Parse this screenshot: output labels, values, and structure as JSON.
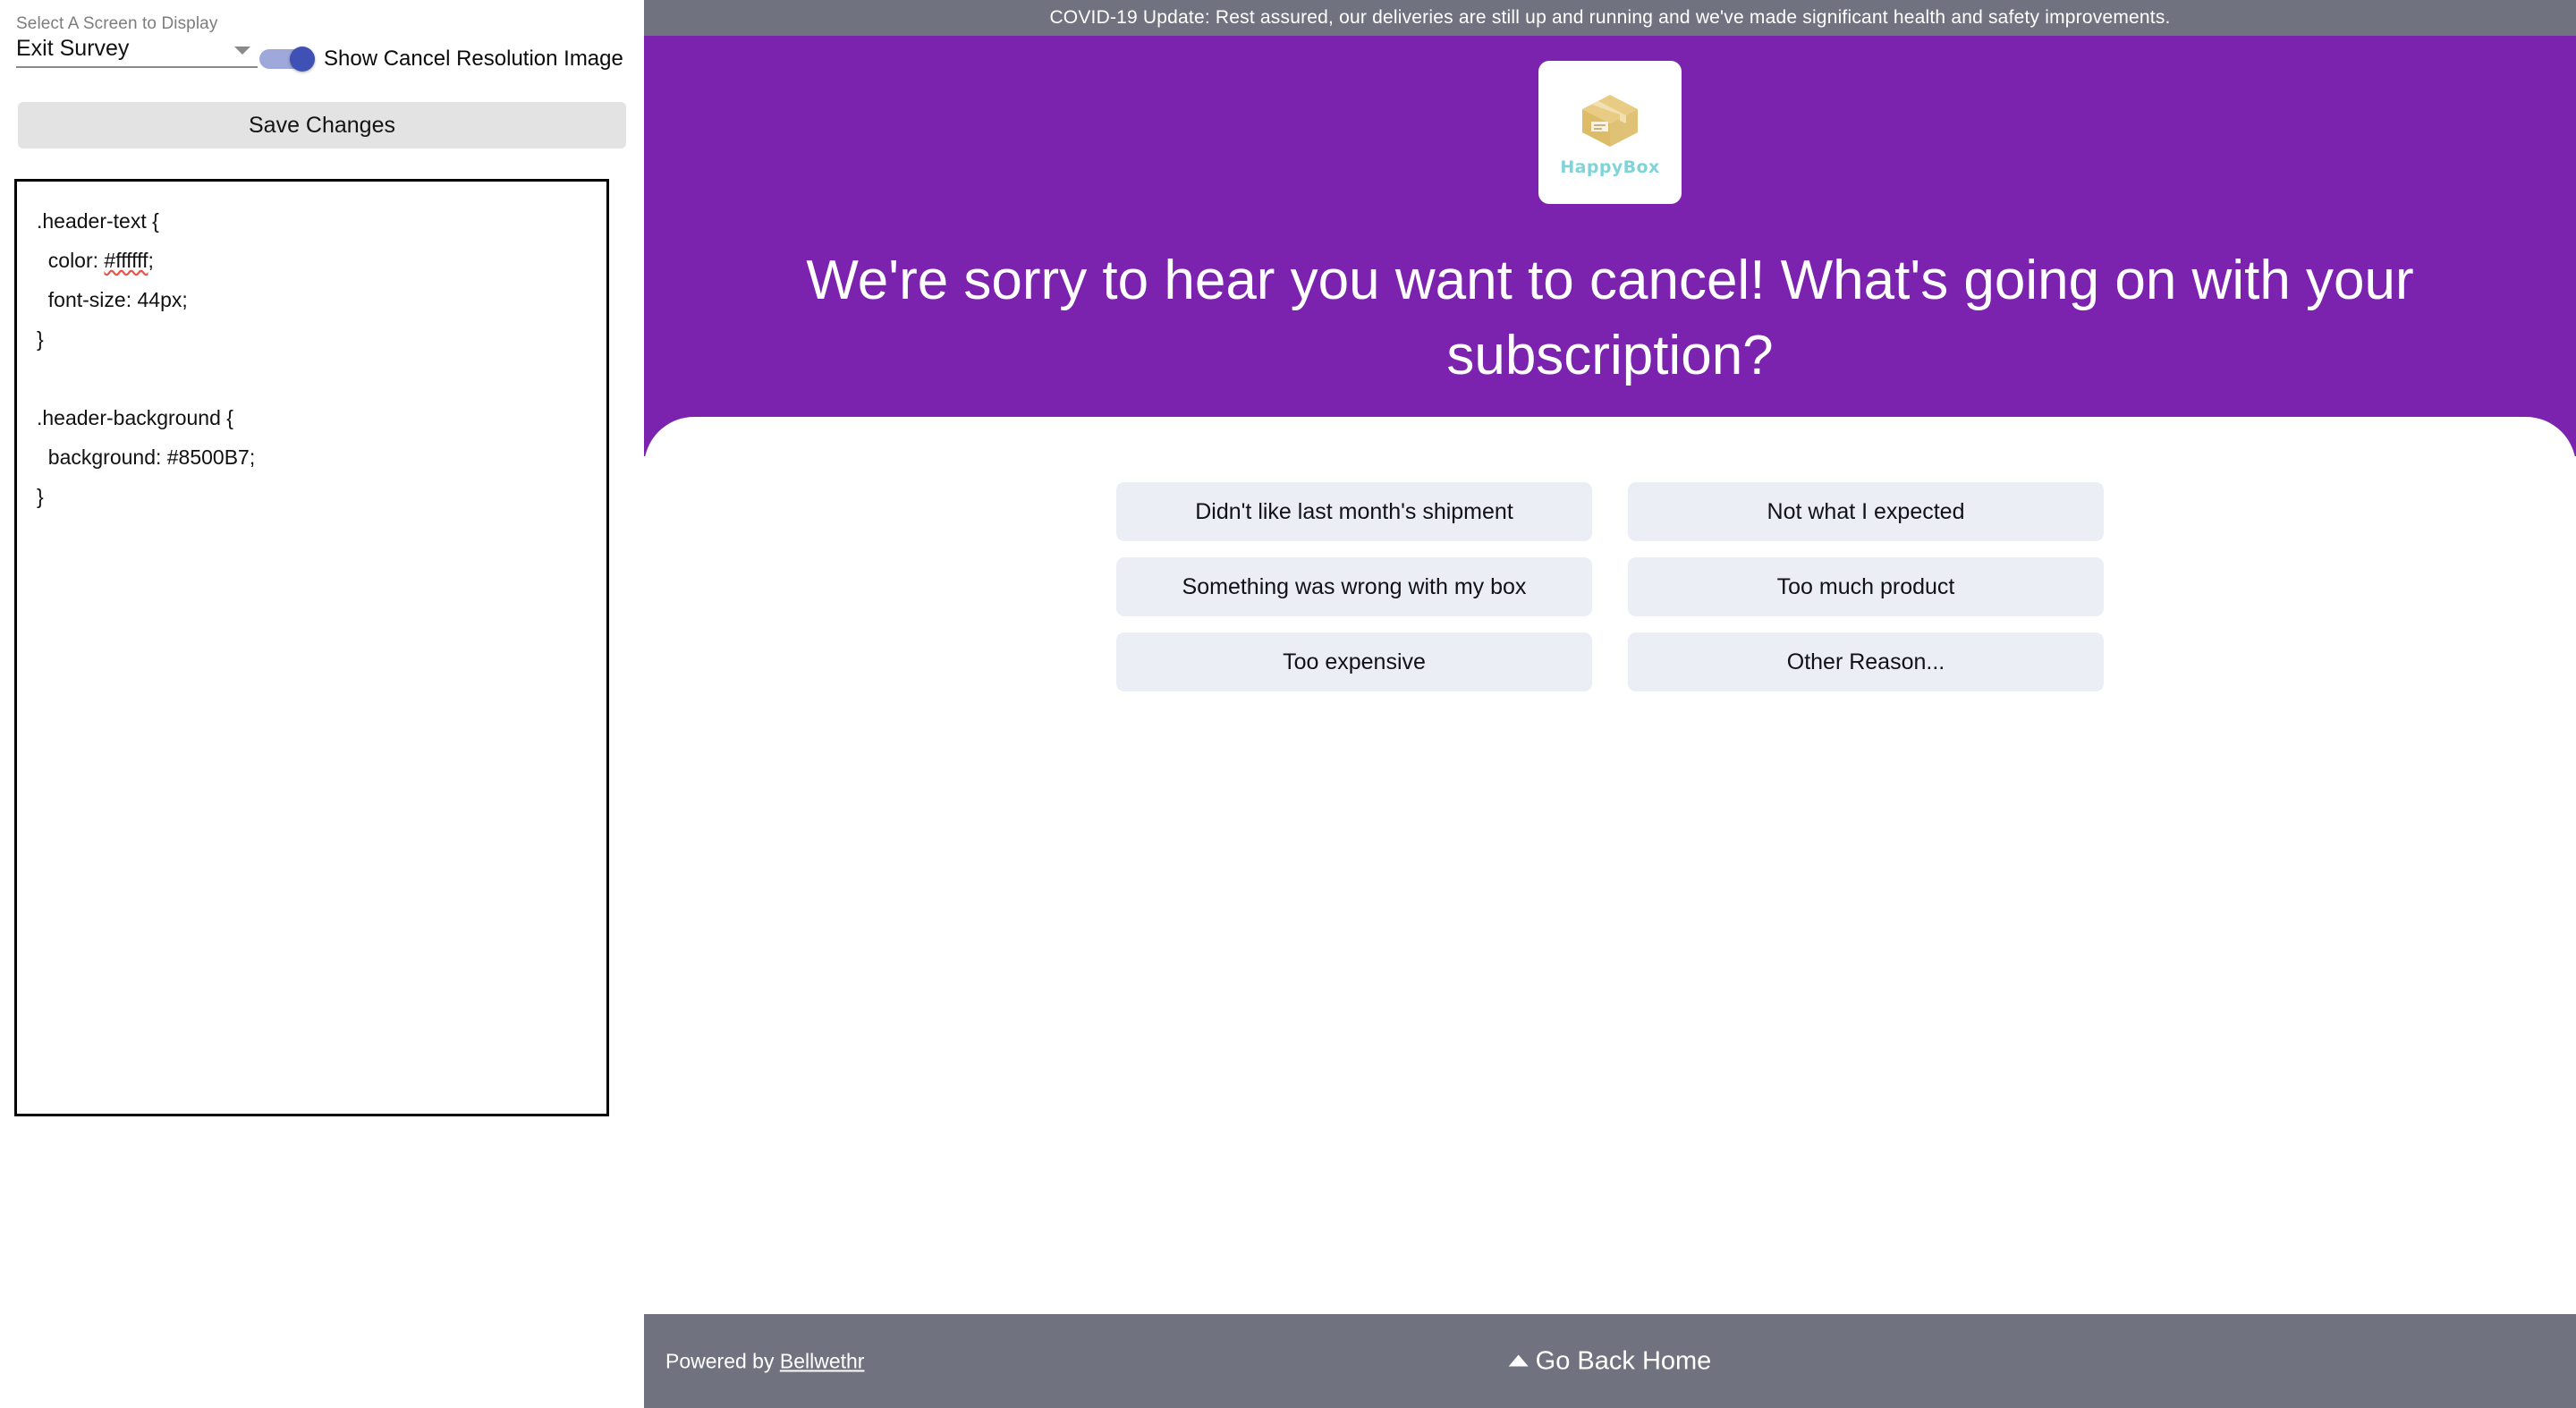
{
  "admin": {
    "screen_select": {
      "label": "Select A Screen to Display",
      "value": "Exit Survey",
      "arrow_icon": "chevron-down-icon"
    },
    "toggle": {
      "label": "Show Cancel Resolution Image",
      "state": "on"
    },
    "save_label": "Save Changes",
    "css_editor": {
      "line1": ".header-text {",
      "line2_prefix": "  color: ",
      "line2_value": "#ffffff",
      "line2_suffix": ";",
      "line3": "  font-size: 44px;",
      "line4": "}",
      "line5": "",
      "line6": ".header-background {",
      "line7": "  background: #8500B7;",
      "line8": "}"
    }
  },
  "preview": {
    "banner": {
      "text": "COVID-19 Update: Rest assured, our deliveries are still up and running and we've made significant health and safety improvements.",
      "background": "#70737f"
    },
    "logo": {
      "wordmark": "HappyBox",
      "wordmark_color": "#7fd4d8",
      "icon": "cardboard-box-icon"
    },
    "header": {
      "text": "We're sorry to hear you want to cancel! What's going on with your subscription?",
      "background": "#8500B7",
      "color": "#ffffff",
      "font_size": "44px"
    },
    "options": [
      "Didn't like last month's shipment",
      "Not what I expected",
      "Something was wrong with my box",
      "Too much product",
      "Too expensive",
      "Other Reason..."
    ],
    "footer": {
      "powered_prefix": "Powered by ",
      "powered_brand": "Bellwethr",
      "home_label": "Go Back Home",
      "home_icon": "chevron-up-icon",
      "background": "#70737f"
    }
  }
}
